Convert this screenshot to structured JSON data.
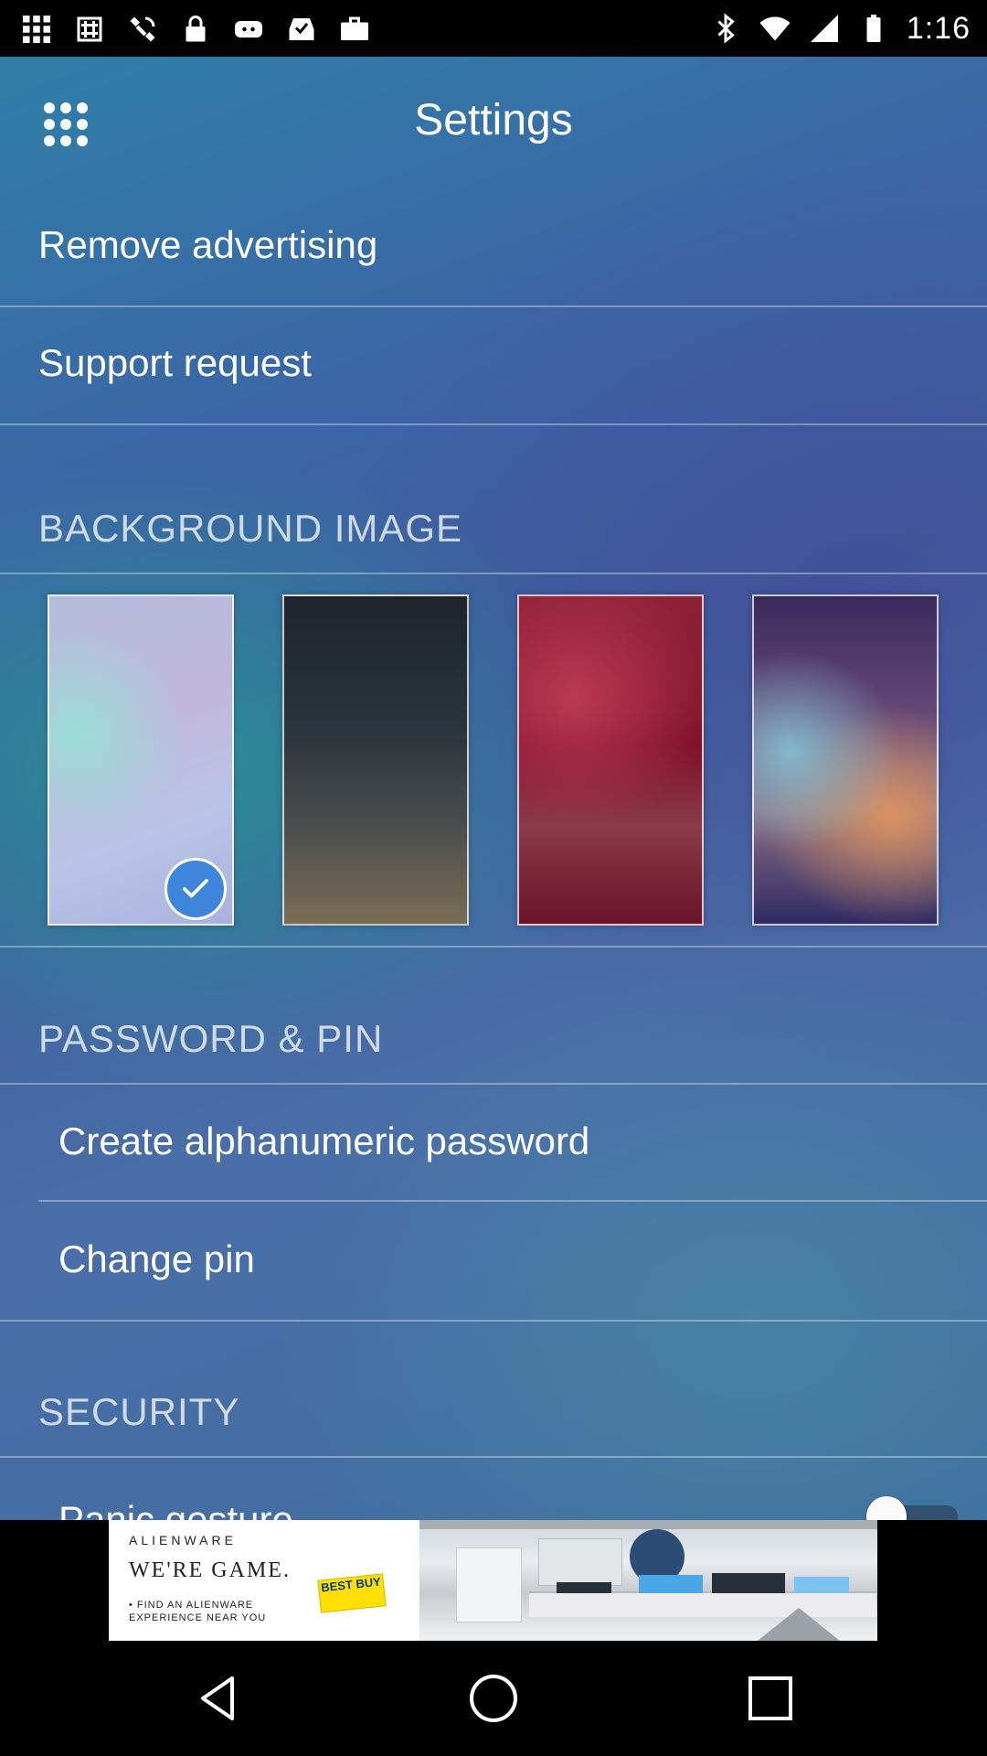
{
  "status_bar": {
    "time": "1:16",
    "left_icons": [
      "grid-app-icon",
      "hashtag-app-icon",
      "satellite-app-icon",
      "lock-app-icon",
      "game-app-icon",
      "inbox-check-icon",
      "briefcase-icon"
    ],
    "right_icons": [
      "bluetooth-icon",
      "wifi-icon",
      "cellular-signal-icon",
      "battery-icon"
    ]
  },
  "header": {
    "title": "Settings",
    "menu_icon": "apps-grid-icon"
  },
  "menu": {
    "remove_advertising": "Remove advertising",
    "support_request": "Support request"
  },
  "background_image": {
    "section_title": "BACKGROUND IMAGE",
    "options": [
      {
        "name": "light-lavender",
        "selected": true
      },
      {
        "name": "dark-slate",
        "selected": false
      },
      {
        "name": "crimson",
        "selected": false
      },
      {
        "name": "purple-peach",
        "selected": false
      }
    ],
    "check_icon": "checkmark-icon",
    "check_color": "#3d86db"
  },
  "password_pin": {
    "section_title": "PASSWORD & PIN",
    "create_password": "Create alphanumeric password",
    "change_pin": "Change pin"
  },
  "security": {
    "section_title": "SECURITY",
    "panic_gesture": "Panic gesture",
    "panic_gesture_enabled": false
  },
  "ad": {
    "brand": "ALIENWARE",
    "headline": "WE'RE GAME.",
    "subtext": "• FIND AN ALIENWARE EXPERIENCE NEAR YOU",
    "badge": "BEST BUY"
  },
  "nav_bar": {
    "back": "back-icon",
    "home": "home-icon",
    "recents": "recents-icon"
  }
}
